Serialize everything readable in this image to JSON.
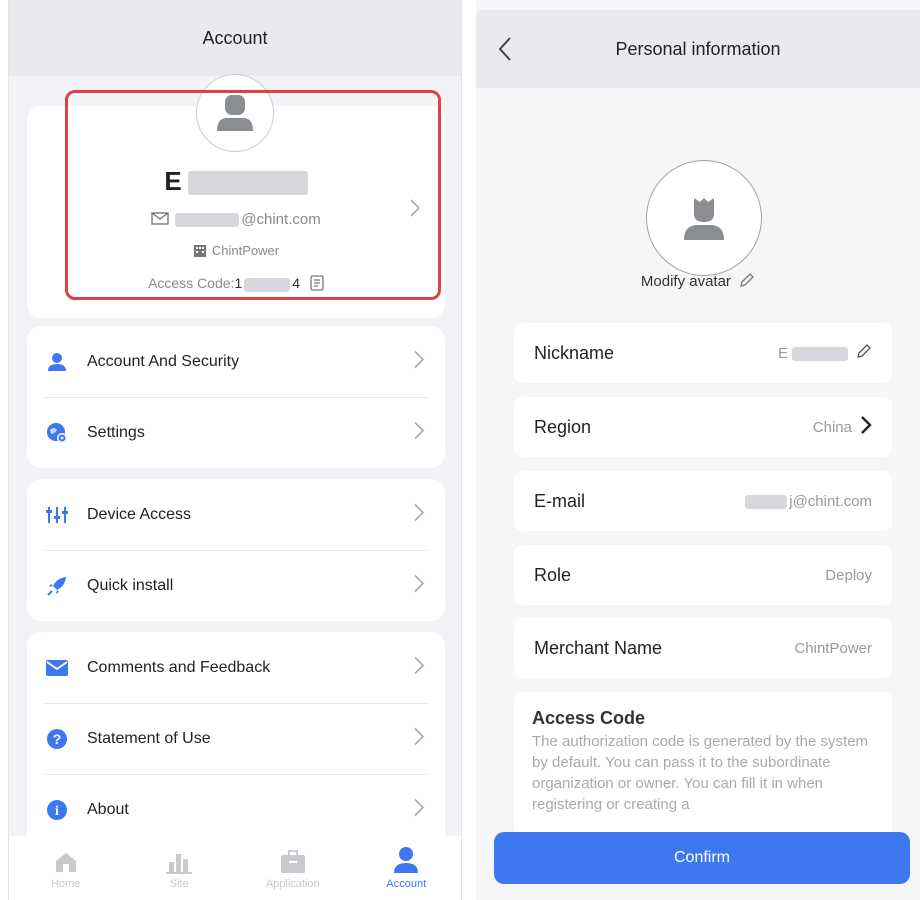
{
  "account_screen": {
    "title": "Account",
    "profile": {
      "name_visible": "E",
      "email_suffix": "@chint.com",
      "organization": "ChintPower",
      "access_code_label": "Access Code:",
      "access_code_first": "1",
      "access_code_last": "4"
    },
    "menu_groups": [
      [
        {
          "label": "Account And Security",
          "icon": "person-icon"
        },
        {
          "label": "Settings",
          "icon": "globe-settings-icon"
        }
      ],
      [
        {
          "label": "Device Access",
          "icon": "sliders-icon"
        },
        {
          "label": "Quick install",
          "icon": "rocket-icon"
        }
      ],
      [
        {
          "label": "Comments and Feedback",
          "icon": "mail-icon"
        },
        {
          "label": "Statement of Use",
          "icon": "question-icon"
        },
        {
          "label": "About",
          "icon": "info-icon"
        }
      ]
    ],
    "tabs": [
      {
        "label": "Home",
        "icon": "home-icon"
      },
      {
        "label": "Site",
        "icon": "chart-icon"
      },
      {
        "label": "Application",
        "icon": "briefcase-icon"
      },
      {
        "label": "Account",
        "icon": "person-icon",
        "active": true
      }
    ]
  },
  "personal_screen": {
    "title": "Personal information",
    "modify_avatar": "Modify avatar",
    "fields": [
      {
        "key": "Nickname",
        "value": "E"
      },
      {
        "key": "Region",
        "value": "China"
      },
      {
        "key": "E-mail",
        "value": "j@chint.com"
      },
      {
        "key": "Role",
        "value": "Deploy"
      },
      {
        "key": "Merchant Name",
        "value": "ChintPower"
      }
    ],
    "access_code": {
      "title": "Access Code",
      "description": "The authorization code is generated by the system by default. You can pass it to the subordinate organization or owner. You can fill it in when registering or creating a"
    },
    "confirm_label": "Confirm"
  },
  "colors": {
    "accent": "#3e78f0",
    "highlight": "#e0413f"
  }
}
